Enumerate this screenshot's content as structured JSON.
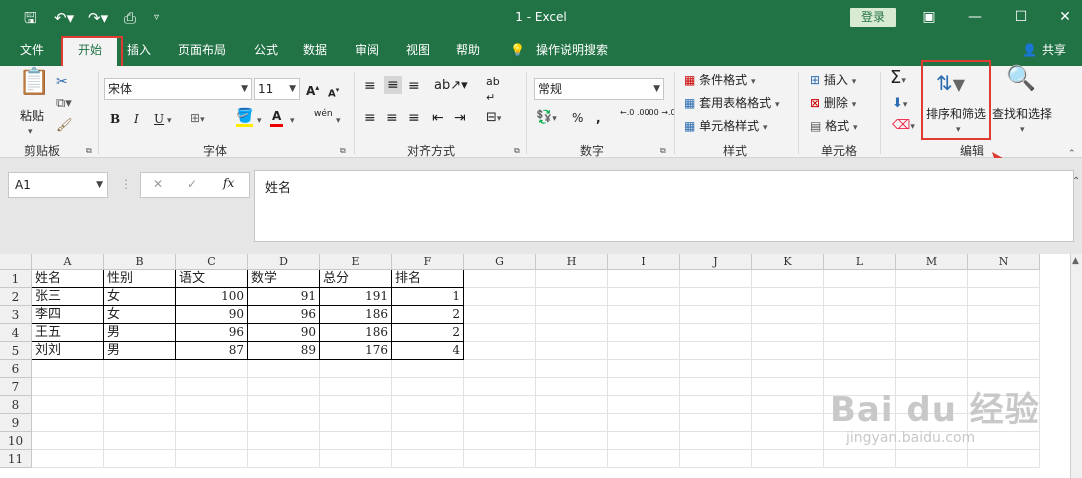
{
  "title": "1 - Excel",
  "login_label": "登录",
  "share_label": "共享",
  "tabs": [
    "文件",
    "开始",
    "插入",
    "页面布局",
    "公式",
    "数据",
    "审阅",
    "视图",
    "帮助"
  ],
  "tellme": "操作说明搜索",
  "clipboard": {
    "paste": "粘贴",
    "group": "剪贴板"
  },
  "font": {
    "name": "宋体",
    "size": "11",
    "group": "字体",
    "bold": "B",
    "italic": "I",
    "underline": "U",
    "grow": "A",
    "shrink": "A",
    "color": "A",
    "phonetic": "wén"
  },
  "alignment": {
    "group": "对齐方式"
  },
  "number": {
    "format": "常规",
    "group": "数字",
    "percent": "%",
    "comma": ",",
    "inc": "←.0 .00",
    "dec": ".00 →.0"
  },
  "styles": {
    "cond": "条件格式",
    "table": "套用表格格式",
    "cell": "单元格样式",
    "group": "样式"
  },
  "cells": {
    "insert": "插入",
    "delete": "删除",
    "format": "格式",
    "group": "单元格"
  },
  "editing": {
    "sort": "排序和筛选",
    "find": "查找和选择",
    "group": "编辑"
  },
  "namebox": "A1",
  "formula": "姓名",
  "columns": [
    "A",
    "B",
    "C",
    "D",
    "E",
    "F",
    "G",
    "H",
    "I",
    "J",
    "K",
    "L",
    "M",
    "N"
  ],
  "rows": [
    "1",
    "2",
    "3",
    "4",
    "5",
    "6",
    "7",
    "8",
    "9",
    "10",
    "11"
  ],
  "table": [
    [
      "姓名",
      "性别",
      "语文",
      "数学",
      "总分",
      "排名"
    ],
    [
      "张三",
      "女",
      "100",
      "91",
      "191",
      "1"
    ],
    [
      "李四",
      "女",
      "90",
      "96",
      "186",
      "2"
    ],
    [
      "王五",
      "男",
      "96",
      "90",
      "186",
      "2"
    ],
    [
      "刘刘",
      "男",
      "87",
      "89",
      "176",
      "4"
    ]
  ],
  "watermark": "Bai du 经验",
  "watermark_url": "jingyan.baidu.com",
  "colors": {
    "excel_green": "#217346",
    "highlight_red": "#e03b30"
  }
}
